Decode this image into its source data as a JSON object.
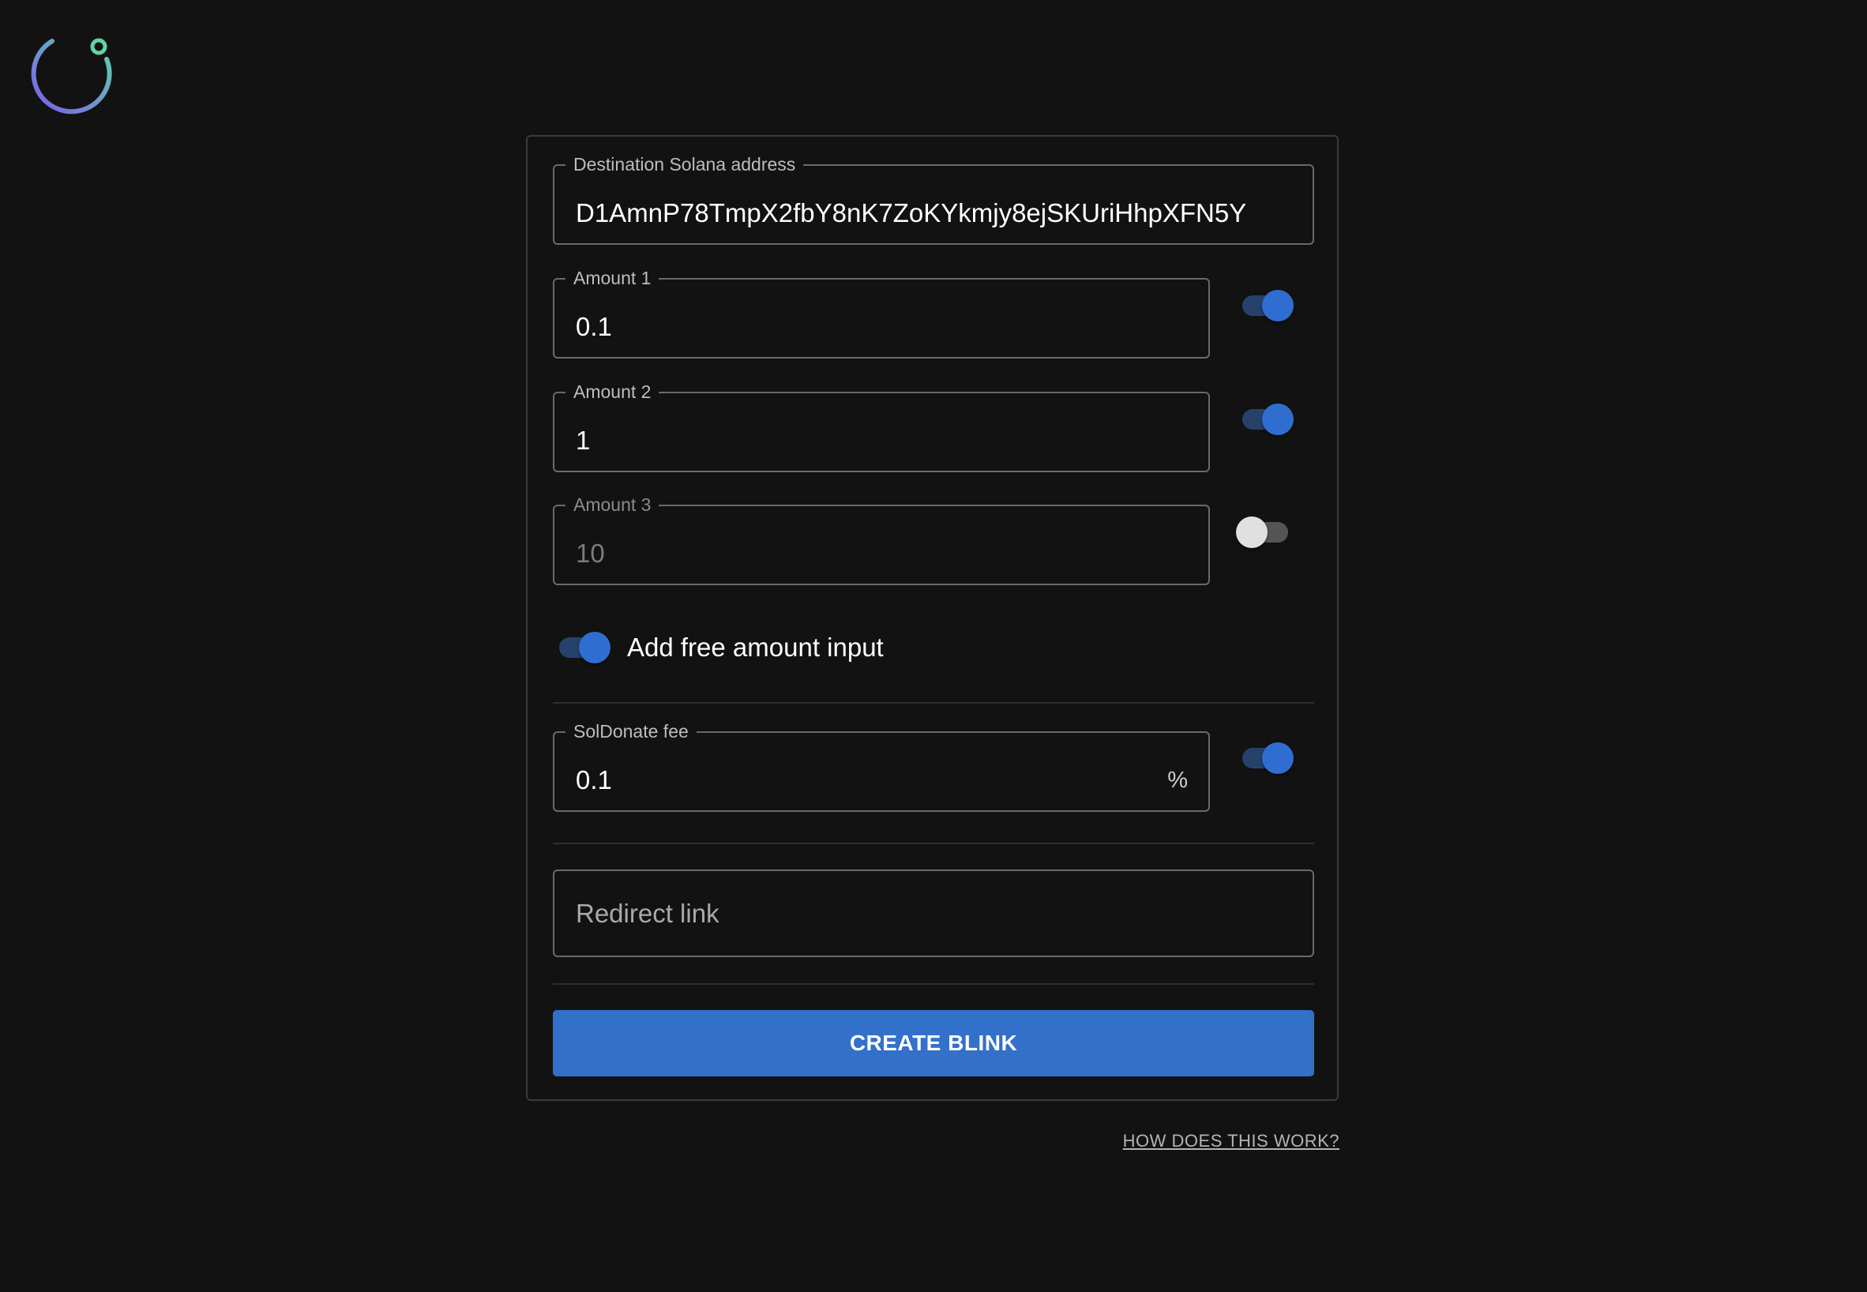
{
  "logo": {
    "icon": "refresh-circle-icon",
    "colors": [
      "#7b5cf0",
      "#5fd6a4"
    ]
  },
  "form": {
    "destination": {
      "label": "Destination Solana address",
      "value": "D1AmnP78TmpX2fbY8nK7ZoKYkmjy8ejSKUriHhpXFN5Y"
    },
    "amounts": [
      {
        "label": "Amount 1",
        "value": "0.1",
        "enabled": true
      },
      {
        "label": "Amount 2",
        "value": "1",
        "enabled": true
      },
      {
        "label": "Amount 3",
        "value": "10",
        "enabled": false
      }
    ],
    "free_amount": {
      "label": "Add free amount input",
      "enabled": true
    },
    "fee": {
      "label": "SolDonate fee",
      "value": "0.1",
      "suffix": "%",
      "enabled": true
    },
    "redirect": {
      "placeholder": "Redirect link"
    },
    "submit_label": "CREATE BLINK"
  },
  "help_link": "HOW DOES THIS WORK?",
  "colors": {
    "background": "#121212",
    "accent": "#3370c9",
    "switch_track_on": "#26426b"
  }
}
